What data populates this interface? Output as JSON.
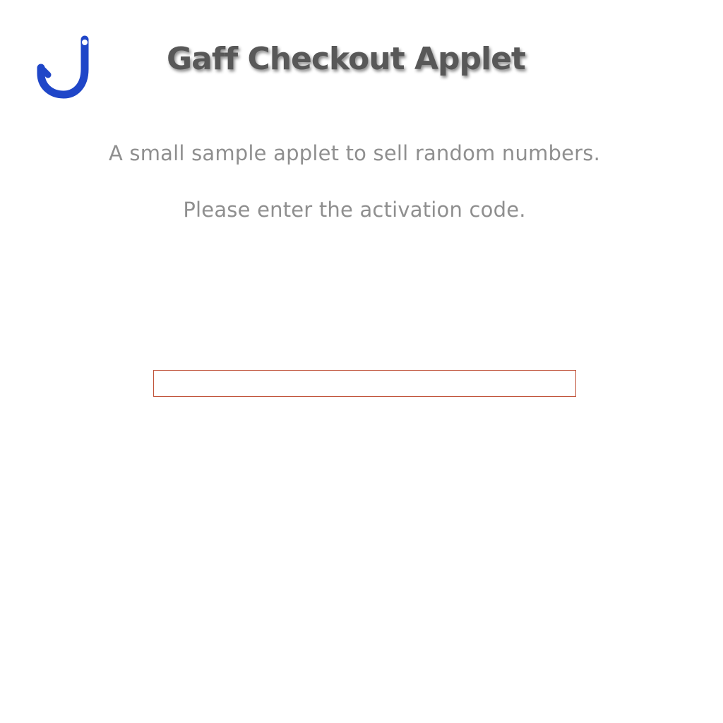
{
  "app": {
    "title": "Gaff Checkout Applet",
    "logo_icon": "hook-icon",
    "logo_color": "#1f46c8"
  },
  "content": {
    "description": "A small sample applet to sell random numbers.",
    "prompt": "Please enter the activation code."
  },
  "activation_code": {
    "value": "",
    "placeholder": "",
    "border_color": "#c0533a"
  }
}
